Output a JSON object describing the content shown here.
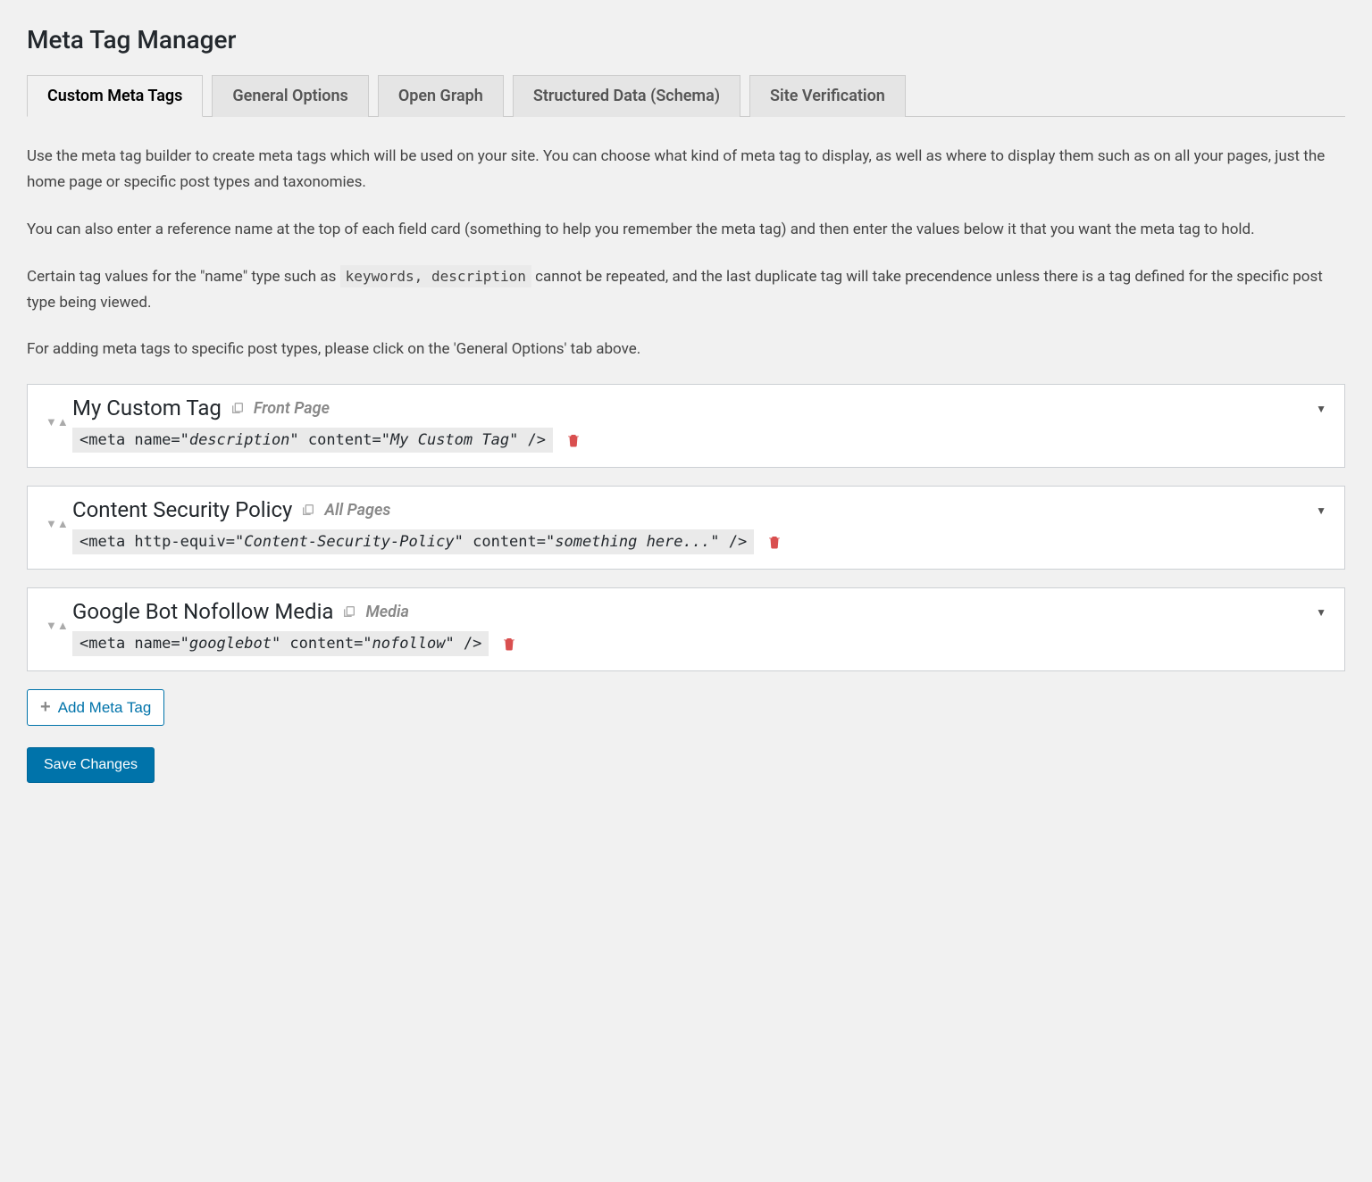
{
  "pageTitle": "Meta Tag Manager",
  "tabs": [
    {
      "label": "Custom Meta Tags",
      "active": true
    },
    {
      "label": "General Options",
      "active": false
    },
    {
      "label": "Open Graph",
      "active": false
    },
    {
      "label": "Structured Data (Schema)",
      "active": false
    },
    {
      "label": "Site Verification",
      "active": false
    }
  ],
  "intro": {
    "p1": "Use the meta tag builder to create meta tags which will be used on your site. You can choose what kind of meta tag to display, as well as where to display them such as on all your pages, just the home page or specific post types and taxonomies.",
    "p2": "You can also enter a reference name at the top of each field card (something to help you remember the meta tag) and then enter the values below it that you want the meta tag to hold.",
    "p3a": "Certain tag values for the \"name\" type such as ",
    "p3code": "keywords, description",
    "p3b": " cannot be repeated, and the last duplicate tag will take precendence unless there is a tag defined for the specific post type being viewed.",
    "p4": "For adding meta tags to specific post types, please click on the 'General Options' tab above."
  },
  "tags": [
    {
      "title": "My Custom Tag",
      "scope": "Front Page",
      "attrType": "name",
      "attrValue": "description",
      "content": "My Custom Tag"
    },
    {
      "title": "Content Security Policy",
      "scope": "All Pages",
      "attrType": "http-equiv",
      "attrValue": "Content-Security-Policy",
      "content": "something here..."
    },
    {
      "title": "Google Bot Nofollow Media",
      "scope": "Media",
      "attrType": "name",
      "attrValue": "googlebot",
      "content": "nofollow"
    }
  ],
  "addBtn": "Add Meta Tag",
  "saveBtn": "Save Changes"
}
